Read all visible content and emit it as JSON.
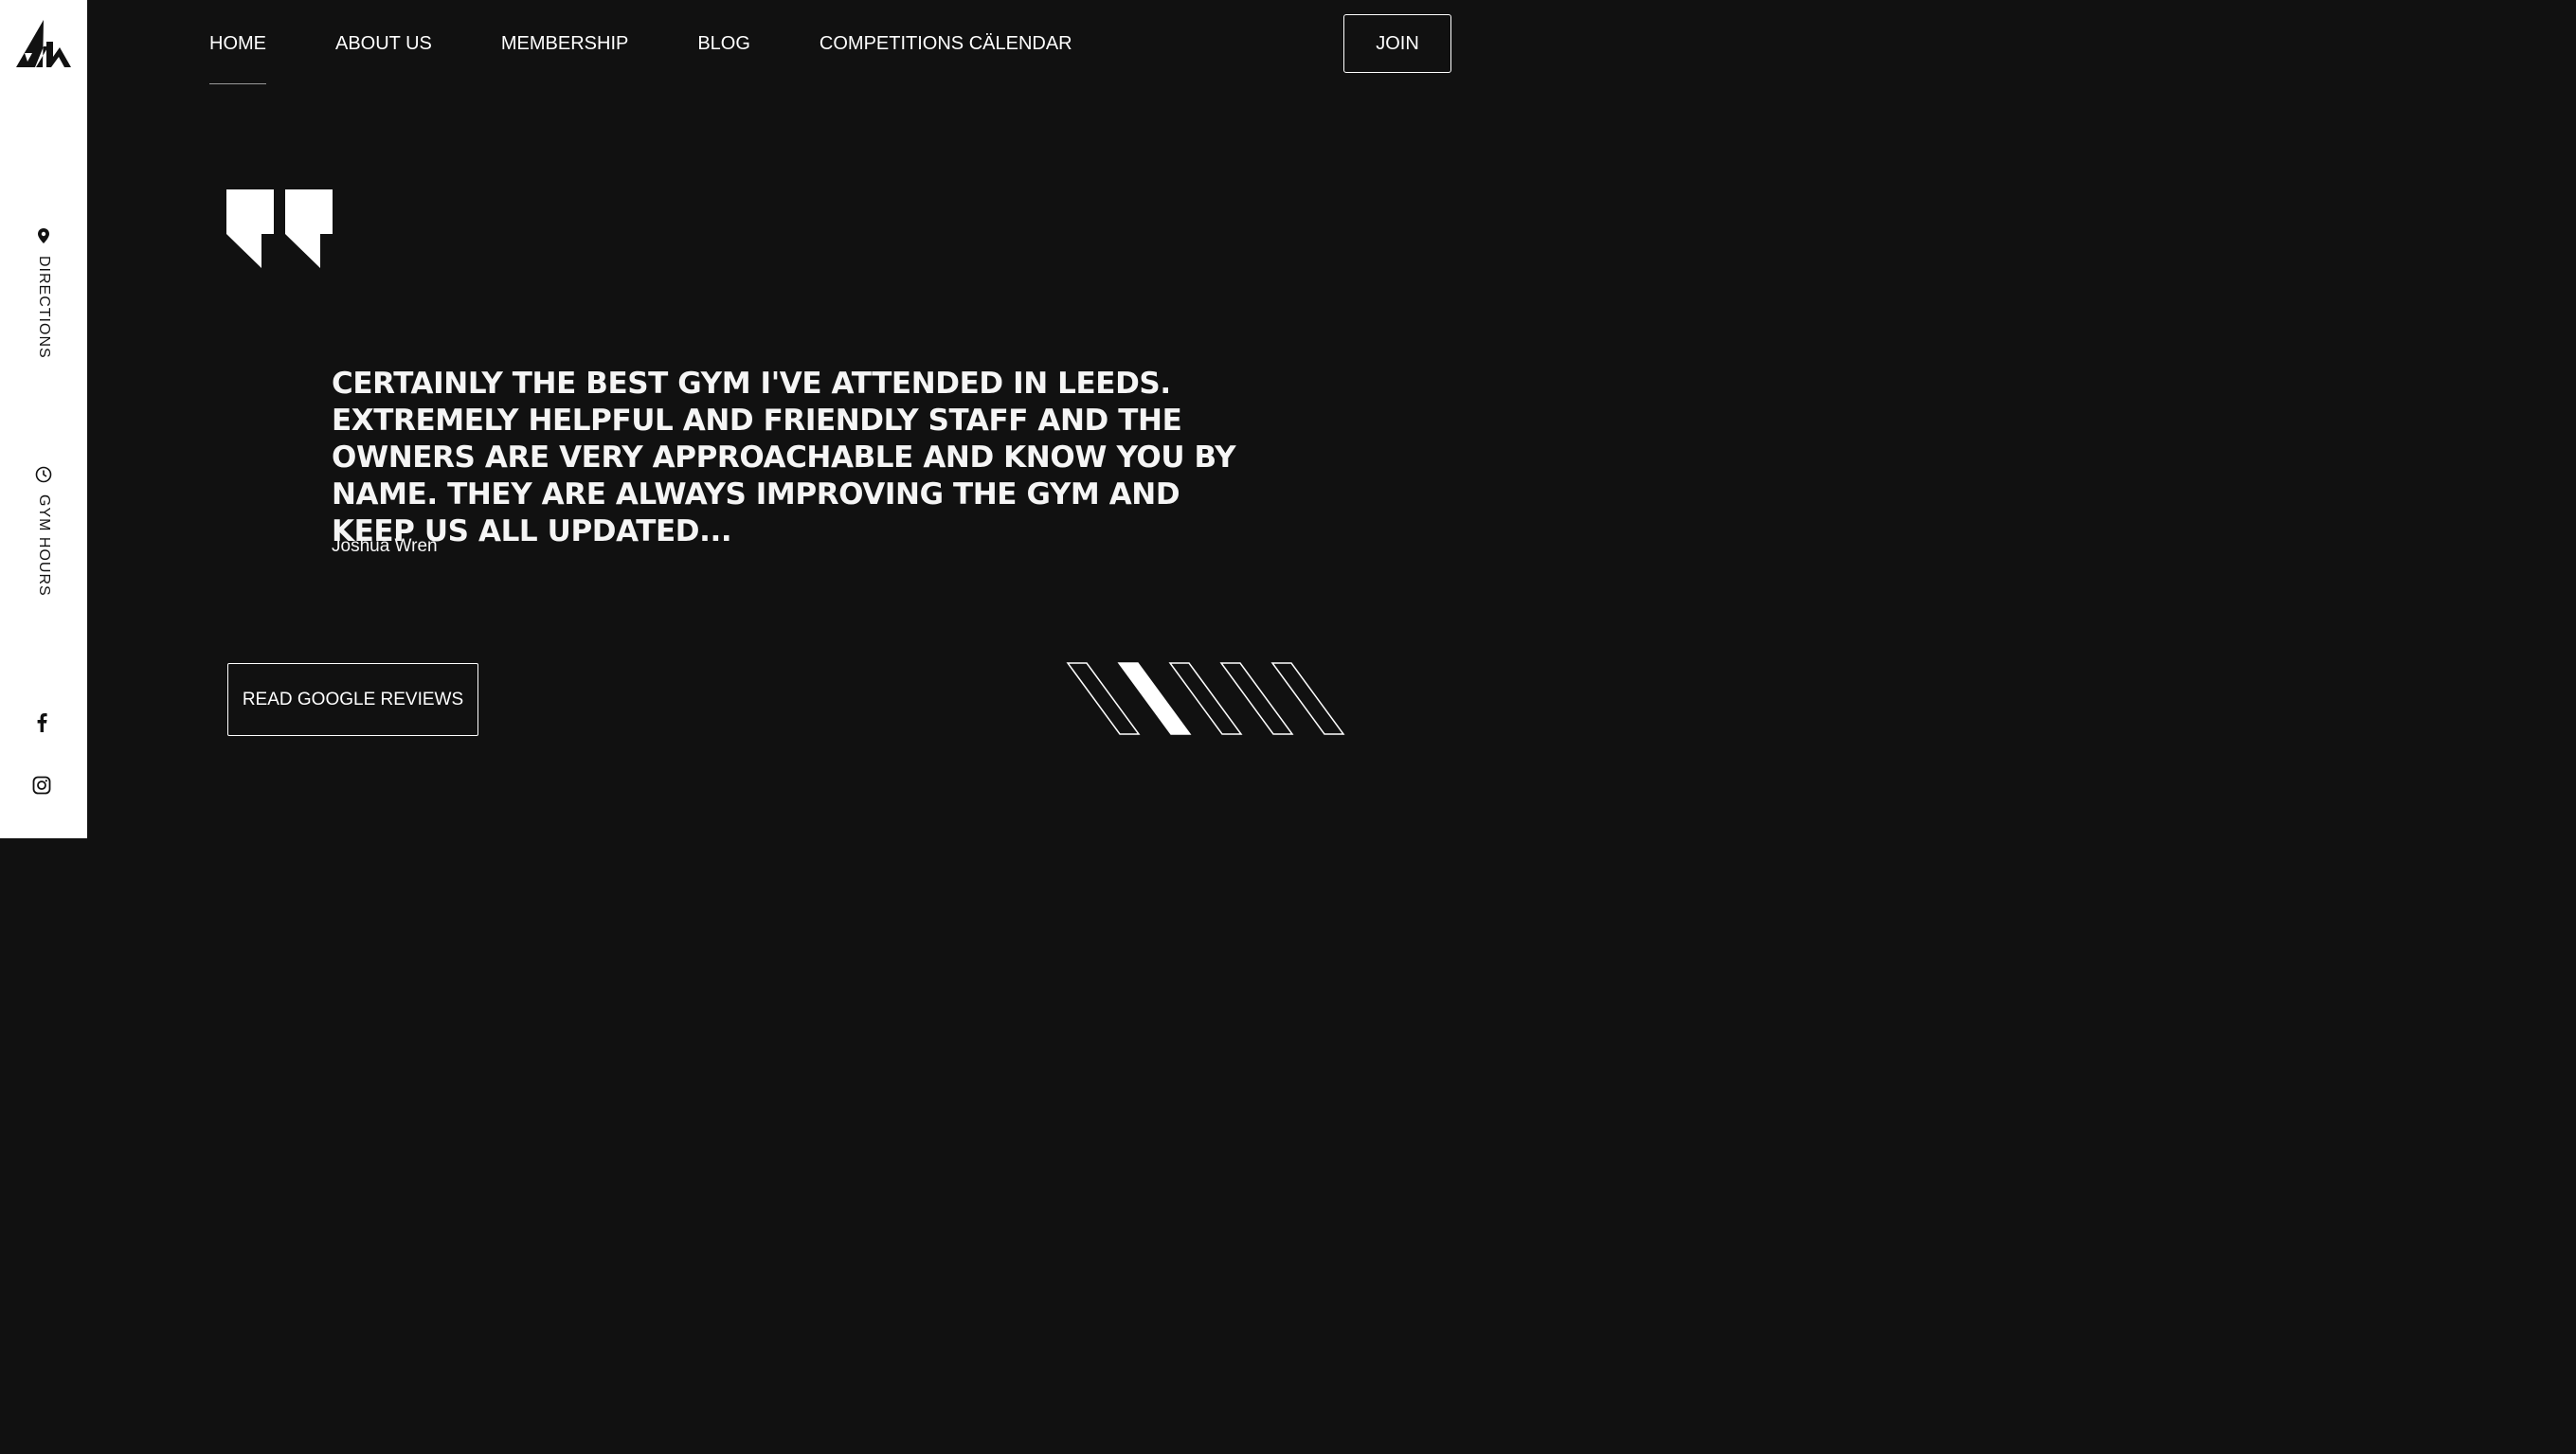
{
  "sidebar": {
    "links": [
      {
        "label": "DIRECTIONS",
        "icon": "map-pin-icon"
      },
      {
        "label": "GYM HOURS",
        "icon": "clock-icon"
      }
    ],
    "social": [
      {
        "icon": "facebook-icon"
      },
      {
        "icon": "instagram-icon"
      }
    ]
  },
  "nav": {
    "items": [
      {
        "label": "HOME",
        "active": true
      },
      {
        "label": "ABOUT US",
        "active": false
      },
      {
        "label": "MEMBERSHIP",
        "active": false
      },
      {
        "label": "BLOG",
        "active": false
      },
      {
        "label": "COMPETITIONS CÄLENDAR",
        "active": false
      }
    ],
    "join_label": "JOIN"
  },
  "testimonial": {
    "quote": "CERTAINLY THE BEST GYM I'VE ATTENDED IN LEEDS. EXTREMELY HELPFUL AND FRIENDLY STAFF AND THE OWNERS ARE VERY APPROACHABLE AND KNOW YOU BY NAME. THEY ARE ALWAYS IMPROVING THE GYM AND KEEP US ALL UPDATED...",
    "author": "Joshua Wren",
    "button_label": "READ GOOGLE REVIEWS",
    "slides_total": 5,
    "active_slide": 2
  },
  "colors": {
    "background": "#111111",
    "sidebar": "#ffffff",
    "text": "#ffffff"
  }
}
